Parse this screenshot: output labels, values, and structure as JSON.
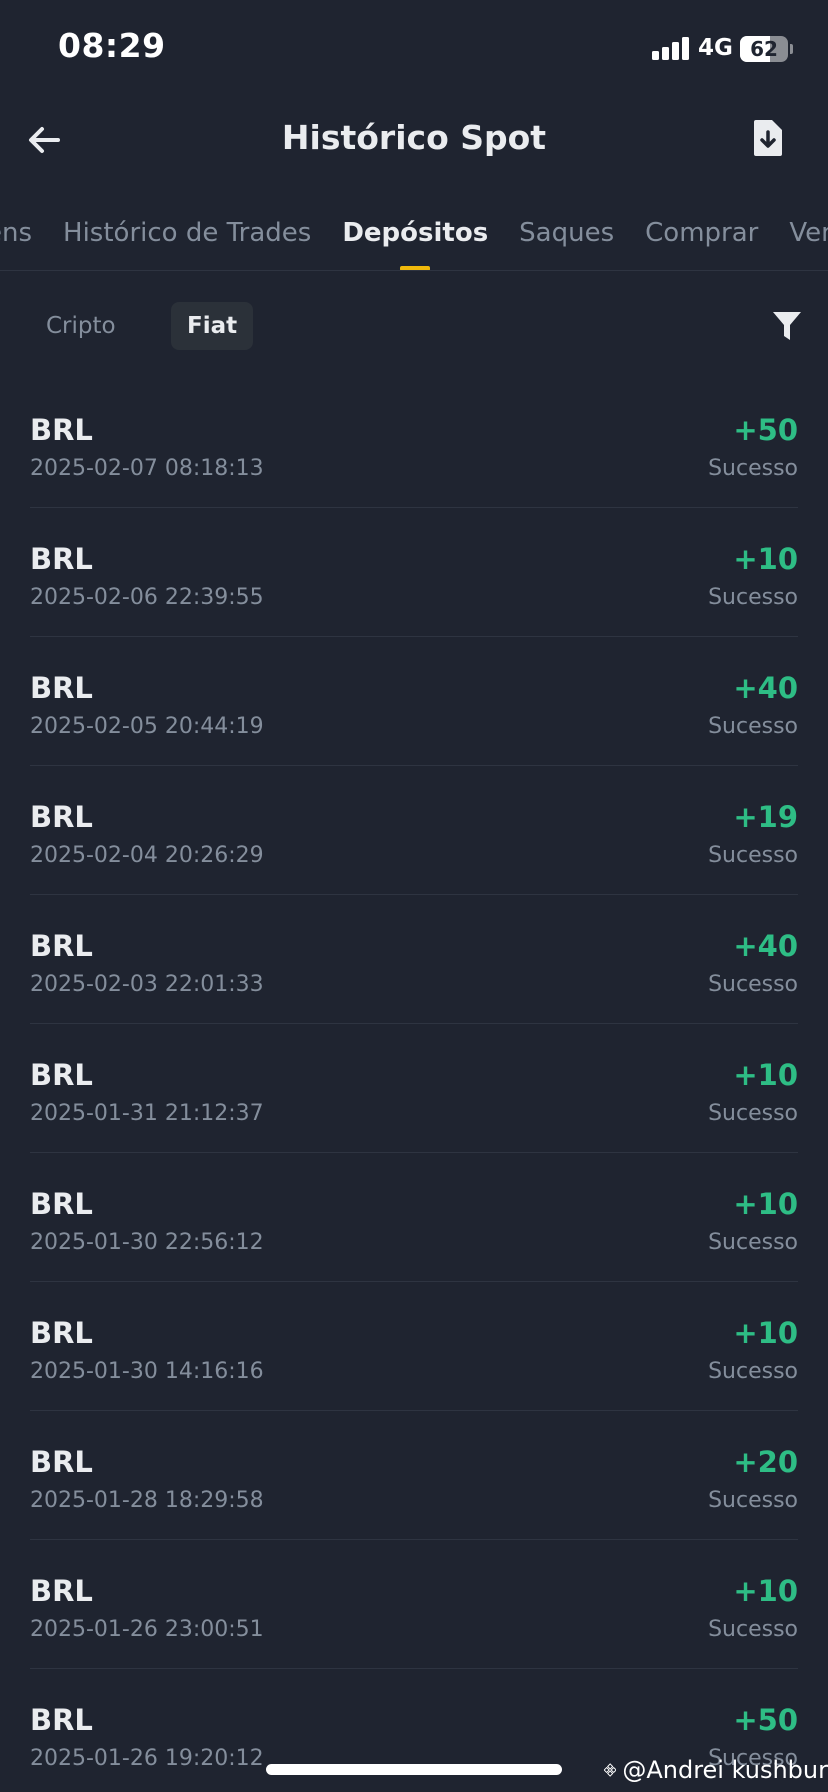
{
  "status_bar": {
    "time": "08:29",
    "network": "4G",
    "battery": "62",
    "battery_level": 0.62
  },
  "header": {
    "title": "Histórico Spot"
  },
  "tabs": [
    {
      "label": "ens",
      "active": false
    },
    {
      "label": "Histórico de Trades",
      "active": false
    },
    {
      "label": "Depósitos",
      "active": true
    },
    {
      "label": "Saques",
      "active": false
    },
    {
      "label": "Comprar",
      "active": false
    },
    {
      "label": "Vend",
      "active": false
    }
  ],
  "subfilter": {
    "cripto": "Cripto",
    "fiat": "Fiat",
    "selected": "Fiat"
  },
  "deposits": [
    {
      "asset": "BRL",
      "time": "2025-02-07 08:18:13",
      "amount": "+50",
      "status": "Sucesso"
    },
    {
      "asset": "BRL",
      "time": "2025-02-06 22:39:55",
      "amount": "+10",
      "status": "Sucesso"
    },
    {
      "asset": "BRL",
      "time": "2025-02-05 20:44:19",
      "amount": "+40",
      "status": "Sucesso"
    },
    {
      "asset": "BRL",
      "time": "2025-02-04 20:26:29",
      "amount": "+19",
      "status": "Sucesso"
    },
    {
      "asset": "BRL",
      "time": "2025-02-03 22:01:33",
      "amount": "+40",
      "status": "Sucesso"
    },
    {
      "asset": "BRL",
      "time": "2025-01-31 21:12:37",
      "amount": "+10",
      "status": "Sucesso"
    },
    {
      "asset": "BRL",
      "time": "2025-01-30 22:56:12",
      "amount": "+10",
      "status": "Sucesso"
    },
    {
      "asset": "BRL",
      "time": "2025-01-30 14:16:16",
      "amount": "+10",
      "status": "Sucesso"
    },
    {
      "asset": "BRL",
      "time": "2025-01-28 18:29:58",
      "amount": "+20",
      "status": "Sucesso"
    },
    {
      "asset": "BRL",
      "time": "2025-01-26 23:00:51",
      "amount": "+10",
      "status": "Sucesso"
    },
    {
      "asset": "BRL",
      "time": "2025-01-26 19:20:12",
      "amount": "+50",
      "status": "Sucesso"
    }
  ],
  "watermark": {
    "text": "@Andrei kushbur"
  },
  "colors": {
    "background": "#1f2430",
    "accent": "#f0b90b",
    "positive": "#2ebd85",
    "muted_text": "#848e9c"
  },
  "icons": {
    "back": "arrow-left-icon",
    "export": "file-download-icon",
    "filter": "funnel-icon"
  }
}
